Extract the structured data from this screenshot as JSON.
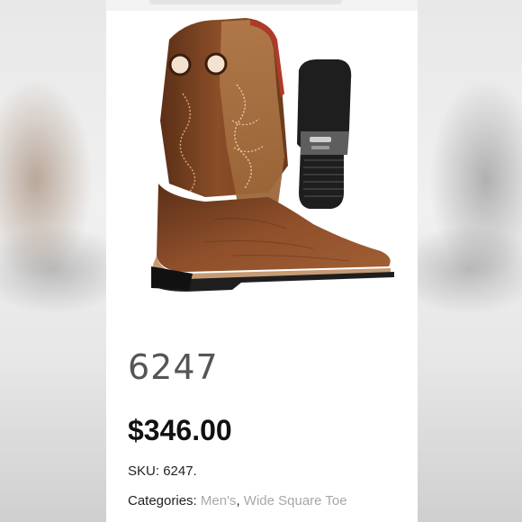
{
  "product": {
    "title": "6247",
    "price": "$346.00",
    "sku_label": "SKU:",
    "sku_value": "6247.",
    "categories_label": "Categories:",
    "categories": [
      "Men's",
      "Wide Square Toe"
    ],
    "separator": ", "
  },
  "colors": {
    "leather_dark": "#6e3c1f",
    "leather_mid": "#8a4e28",
    "shaft_tan": "#a8703f",
    "sole_black": "#1e1e1e",
    "link_gray": "#a8a8a8"
  }
}
